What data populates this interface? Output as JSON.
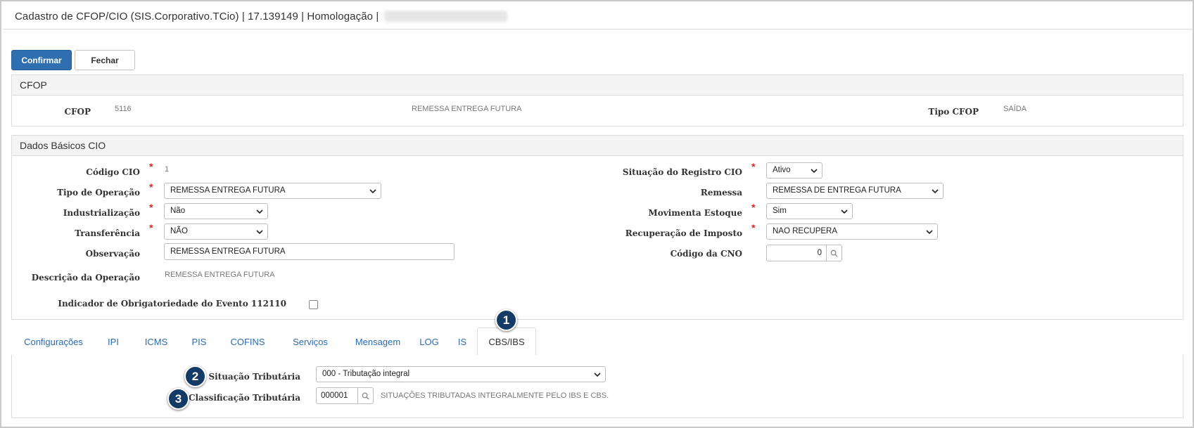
{
  "window": {
    "title": "Cadastro de CFOP/CIO (SIS.Corporativo.TCio) | 17.139149 | Homologação |"
  },
  "toolbar": {
    "confirm_label": "Confirmar",
    "close_label": "Fechar"
  },
  "cfop_panel": {
    "heading": "CFOP",
    "cfop_label": "CFOP",
    "cfop_code": "5116",
    "cfop_description": "REMESSA ENTREGA FUTURA",
    "tipo_label": "Tipo CFOP",
    "tipo_value": "SAÍDA"
  },
  "cio_panel": {
    "heading": "Dados Básicos CIO",
    "codigo_label": "Código CIO",
    "codigo_value": "1",
    "tipo_operacao_label": "Tipo de Operação",
    "tipo_operacao_value": "REMESSA ENTREGA FUTURA",
    "industrializacao_label": "Industrialização",
    "industrializacao_value": "Não",
    "transferencia_label": "Transferência",
    "transferencia_value": "NÃO",
    "observacao_label": "Observação",
    "observacao_value": "REMESSA ENTREGA FUTURA",
    "descricao_label": "Descrição da Operação",
    "descricao_value": "REMESSA ENTREGA FUTURA",
    "indicador_label": "Indicador de Obrigatoriedade do Evento 112110",
    "situacao_label": "Situação do Registro CIO",
    "situacao_value": "Ativo",
    "remessa_label": "Remessa",
    "remessa_value": "REMESSA DE ENTREGA FUTURA",
    "movimenta_label": "Movimenta Estoque",
    "movimenta_value": "Sim",
    "recuperacao_label": "Recuperação de Imposto",
    "recuperacao_value": "NAO RECUPERA",
    "cno_label": "Código da CNO",
    "cno_value": "0"
  },
  "tabs": [
    {
      "label": "Configurações"
    },
    {
      "label": "IPI"
    },
    {
      "label": "ICMS"
    },
    {
      "label": "PIS"
    },
    {
      "label": "COFINS"
    },
    {
      "label": "Serviços"
    },
    {
      "label": "Mensagem"
    },
    {
      "label": "LOG"
    },
    {
      "label": "IS"
    },
    {
      "label": "CBS/IBS"
    }
  ],
  "active_tab": "CBS/IBS",
  "cbs_ibs": {
    "situacao_label": "Situação Tributária",
    "situacao_value": "000 - Tributação integral",
    "classificacao_label": "Classificação Tributária",
    "classificacao_code": "000001",
    "classificacao_description": "SITUAÇÕES TRIBUTADAS INTEGRALMENTE PELO IBS E CBS."
  },
  "callouts": [
    "1",
    "2",
    "3"
  ],
  "colors": {
    "primary_button": "#2f6fb0",
    "tab_link": "#2b6cb0",
    "required": "#e32424",
    "callout": "#143a66"
  }
}
